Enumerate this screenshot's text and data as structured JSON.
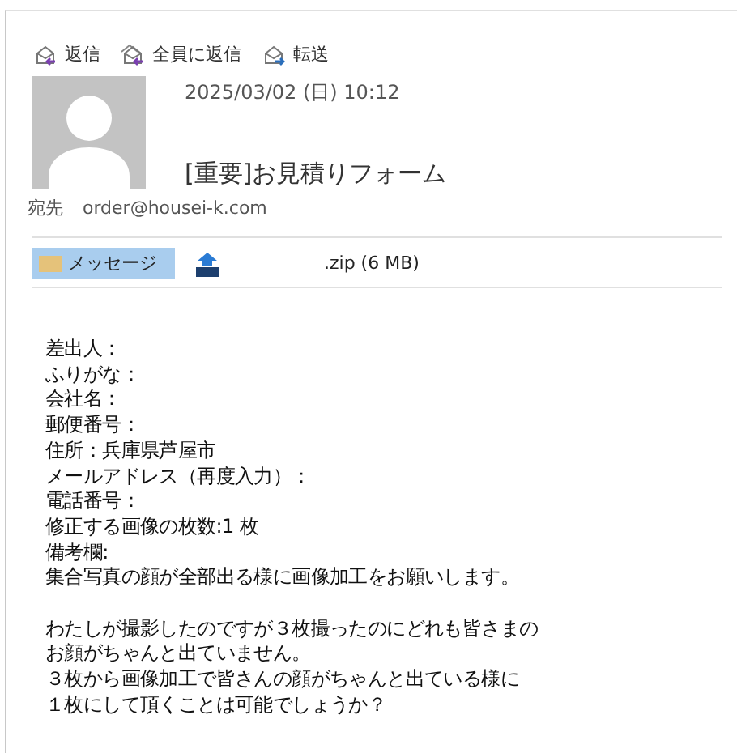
{
  "actions": [
    {
      "kind": "reply",
      "label": "返信"
    },
    {
      "kind": "reply_all",
      "label": "全員に返信"
    },
    {
      "kind": "forward",
      "label": "転送"
    }
  ],
  "header": {
    "date": "2025/03/02 (日) 10:12",
    "subject": "[重要]お見積りフォーム",
    "to_label": "宛先",
    "to": "order@housei-k.com"
  },
  "attachments": [
    {
      "kind": "message",
      "label": "メッセージ",
      "selected": true
    },
    {
      "kind": "zip",
      "label": ".zip (6 MB)",
      "selected": false
    }
  ],
  "body": [
    [
      "差出人：",
      "ふりがな：",
      "会社名：",
      "郵便番号：",
      "住所：兵庫県芦屋市",
      "メールアドレス（再度入力）：",
      "電話番号：",
      "修正する画像の枚数:1 枚",
      "備考欄:",
      "集合写真の顔が全部出る様に画像加工をお願いします。"
    ],
    [
      "わたしが撮影したのですが３枚撮ったのにどれも皆さまの",
      "お顔がちゃんと出ていません。",
      "３枚から画像加工で皆さんの顔がちゃんと出ている様に",
      "１枚にして頂くことは可能でしょうか？"
    ]
  ]
}
